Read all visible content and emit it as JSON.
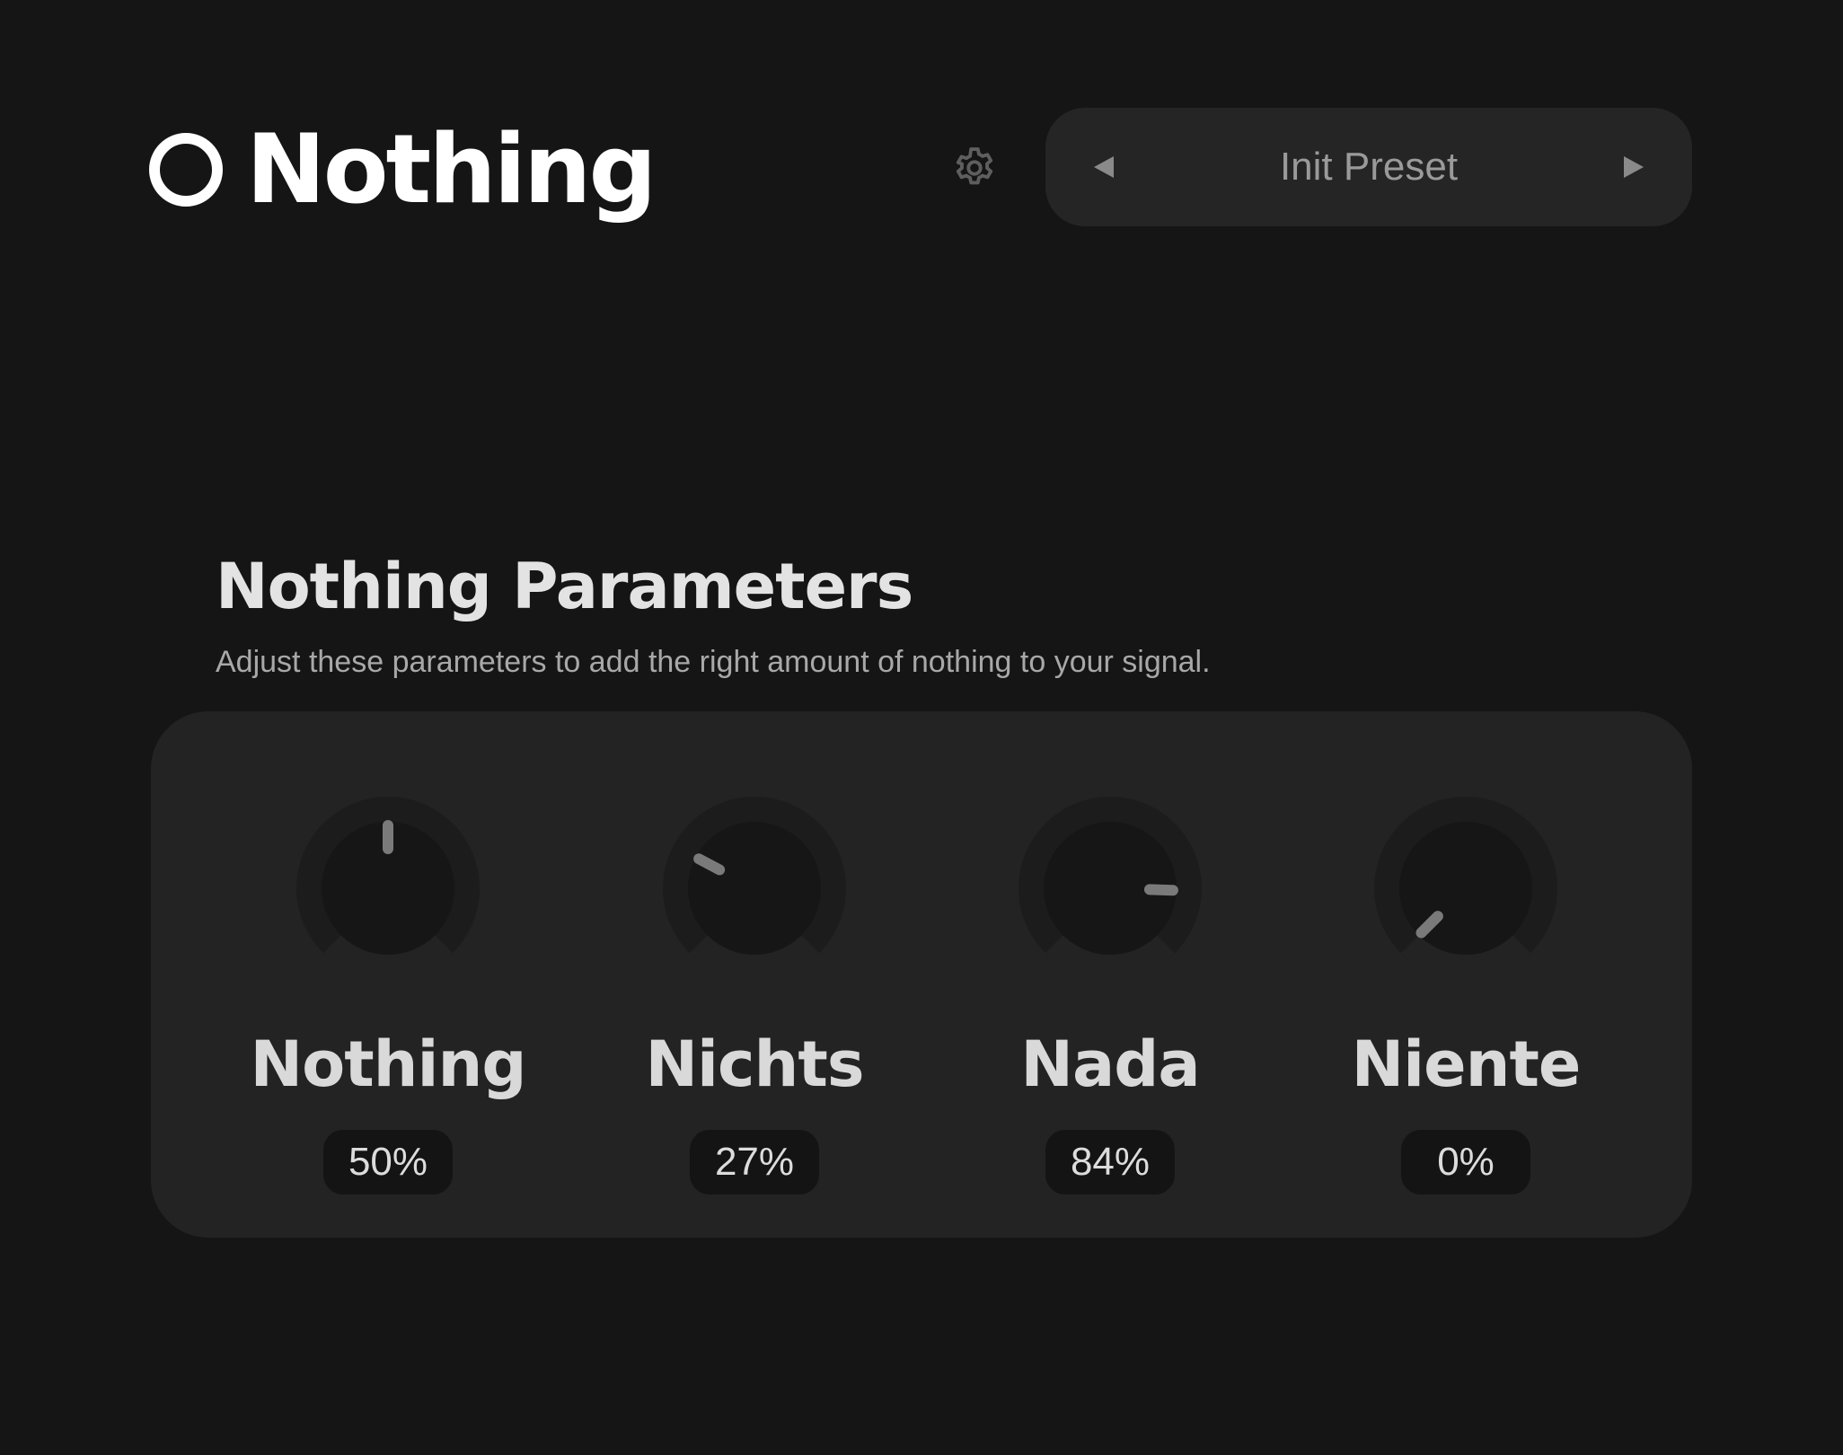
{
  "app": {
    "title": "Nothing"
  },
  "header": {
    "settings_icon": "gear-icon",
    "preset": {
      "name": "Init Preset",
      "prev_icon": "triangle-left-icon",
      "next_icon": "triangle-right-icon"
    }
  },
  "section": {
    "title": "Nothing Parameters",
    "description": "Adjust these parameters to add the right amount of nothing to your signal."
  },
  "knobs": [
    {
      "label": "Nothing",
      "value_text": "50%",
      "value": 0.5
    },
    {
      "label": "Nichts",
      "value_text": "27%",
      "value": 0.27
    },
    {
      "label": "Nada",
      "value_text": "84%",
      "value": 0.84
    },
    {
      "label": "Niente",
      "value_text": "0%",
      "value": 0.0
    }
  ],
  "colors": {
    "background": "#151515",
    "panel": "#232323",
    "knob_indicator": "#7a7a7a",
    "value_pill": "#141414"
  }
}
